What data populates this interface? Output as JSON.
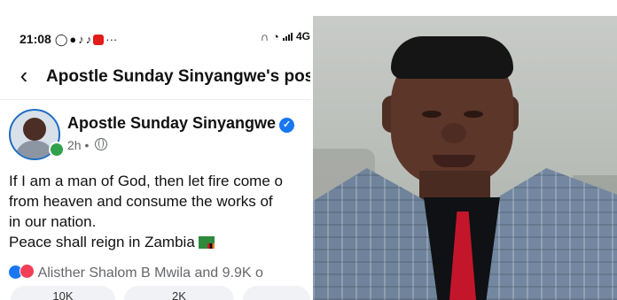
{
  "status_bar": {
    "time": "21:08",
    "network": "4G"
  },
  "post_header": {
    "title": "Apostle Sunday Sinyangwe's post"
  },
  "author": {
    "name": "Apostle Sunday Sinyangwe",
    "time": "2h"
  },
  "post": {
    "line1": "If I am a man of God, then let fire come o",
    "line2": "from heaven and consume the works of",
    "line3": "in our nation.",
    "line4": "Peace shall reign in Zambia"
  },
  "reactions": {
    "text": "Alisther Shalom B Mwila and 9.9K o"
  },
  "action_bar": {
    "left": "10K",
    "middle": "2K"
  },
  "icons": [
    "back-arrow-icon",
    "verified-icon",
    "globe-icon",
    "like-reaction-icon",
    "love-reaction-icon",
    "zambia-flag-icon"
  ],
  "colors": {
    "facebook_blue": "#1877f2",
    "online_green": "#31a24c",
    "love_red": "#f33e58"
  }
}
